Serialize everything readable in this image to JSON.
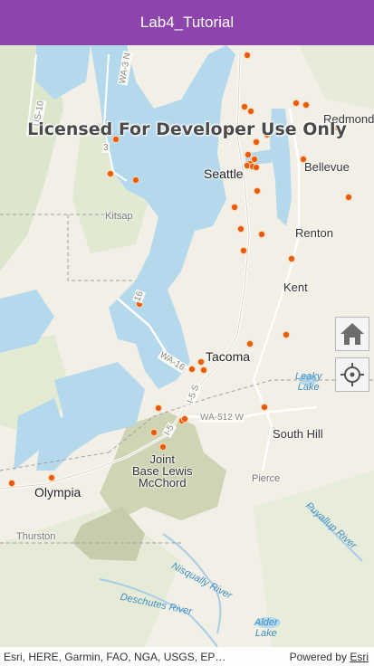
{
  "app": {
    "title": "Lab4_Tutorial"
  },
  "map": {
    "watermark": "Licensed For Developer Use Only",
    "labels": {
      "seattle": "Seattle",
      "redmond": "Redmond",
      "bellevue": "Bellevue",
      "renton": "Renton",
      "kent": "Kent",
      "tacoma": "Tacoma",
      "south_hill": "South Hill",
      "olympia": "Olympia",
      "joint_base": "Joint\nBase Lewis\nMcChord",
      "kitsap": "Kitsap",
      "pierce": "Pierce",
      "thurston": "Thurston",
      "leaky_lake": "Leaky\nLake",
      "nisqually_river": "Nisqually River",
      "deschutes_river": "Deschutes River",
      "puyallup_river": "Puyallup River",
      "alder_lake": "Alder\nLake",
      "wa512": "WA-512 W",
      "wa16": "WA-16",
      "i5": "I-5 S",
      "i5b": "I-5",
      "wa3": "WA-3 N",
      "us101": "US-10",
      "r16": "16",
      "r3": "3"
    },
    "controls": {
      "home": "home-icon",
      "locate": "locate-icon"
    },
    "attribution": {
      "sources": "Esri, HERE, Garmin, FAO, NGA, USGS, EP…",
      "powered_by": "Powered by",
      "esri_link": "Esri"
    },
    "colors": {
      "header": "#8e44ad",
      "marker_fill": "#e85a0c",
      "marker_stroke": "#ffd7b0",
      "water": "#b4d9ed",
      "land": "#f2efe6"
    }
  }
}
